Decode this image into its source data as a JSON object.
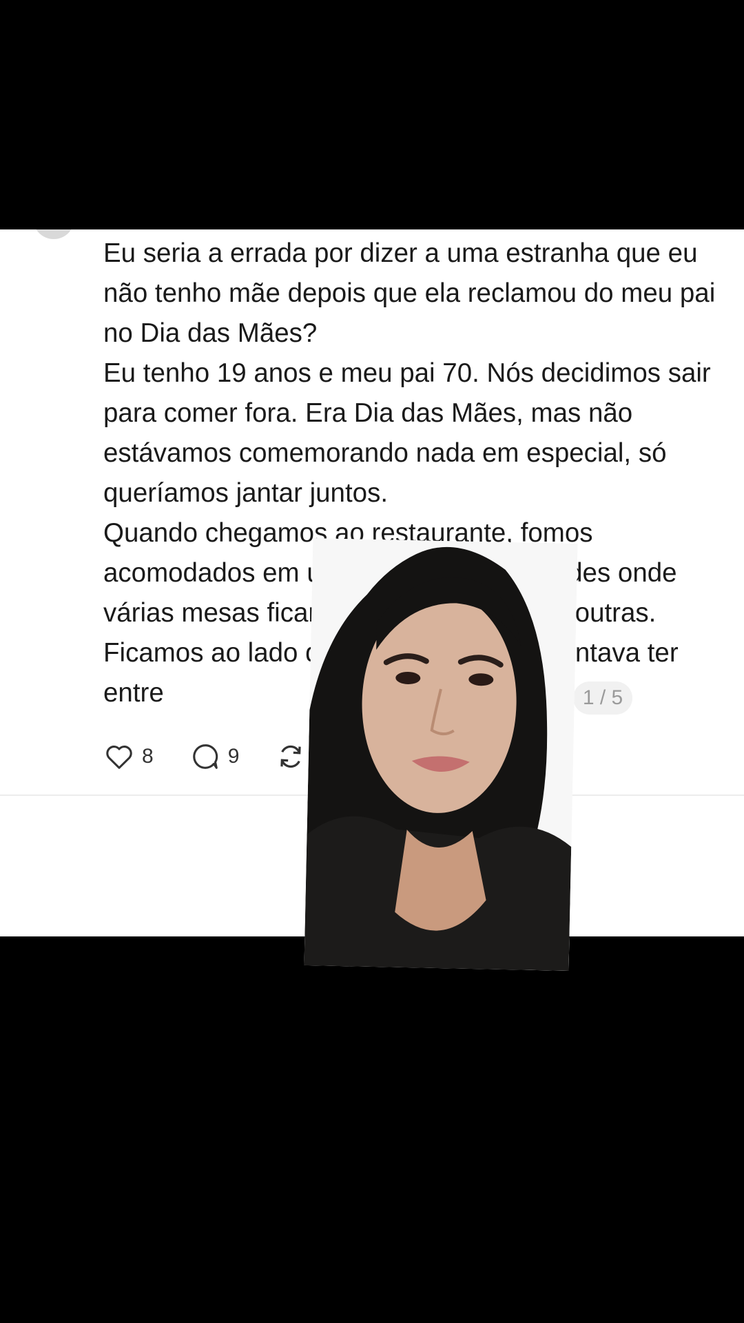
{
  "post": {
    "paragraphs": [
      "Eu seria a errada por dizer a uma estranha que eu não tenho mãe depois que ela reclamou do meu pai no Dia das Mães?",
      "Eu tenho 19 anos e meu pai 70. Nós decidimos sair para comer fora. Era Dia das Mães, mas não estávamos comemorando nada em especial, só queríamos jantar juntos.",
      "Quando chegamos ao restaurante, fomos acomodados em uma das cabines grandes onde várias mesas ficam próximas umas das outras. Ficamos ao lado de um casal que aparentava ter entre"
    ],
    "page_indicator": "1 / 5"
  },
  "actions": {
    "likes": "8",
    "comments": "9"
  },
  "icons": {
    "like": "heart-icon",
    "comment": "comment-bubble-icon",
    "repost": "repost-icon"
  },
  "colors": {
    "background": "#000000",
    "card": "#ffffff",
    "text": "#1a1a1a",
    "muted": "#9a9a9a"
  }
}
